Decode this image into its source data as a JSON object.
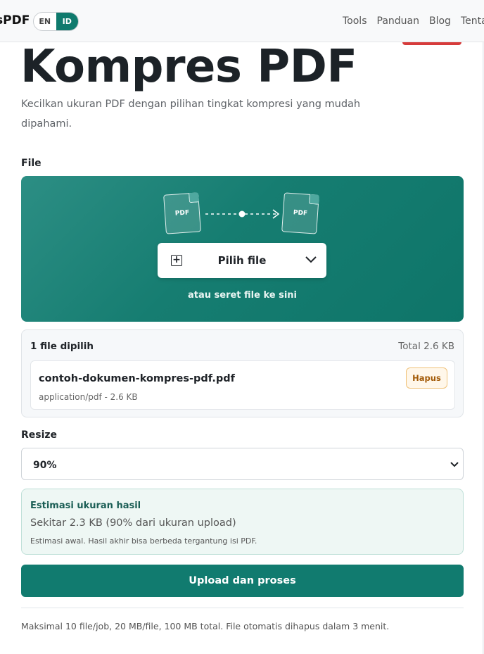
{
  "header": {
    "brand": "sPDF",
    "lang": {
      "en": "EN",
      "id": "ID",
      "active": "ID"
    },
    "nav": [
      "Tools",
      "Panduan",
      "Blog",
      "Tentang"
    ]
  },
  "page": {
    "title": "Kompres PDF",
    "subtitle": "Kecilkan ukuran PDF dengan pilihan tingkat kompresi yang mudah dipahami."
  },
  "file_section": {
    "label": "File",
    "doc_label_left": "PDF",
    "doc_label_right": "PDF",
    "pick_button": "Pilih file",
    "drop_hint": "atau seret file ke sini"
  },
  "selected": {
    "count": "1 file dipilih",
    "total": "Total 2.6 KB",
    "files": [
      {
        "name": "contoh-dokumen-kompres-pdf.pdf",
        "meta": "application/pdf - 2.6 KB",
        "remove": "Hapus"
      }
    ]
  },
  "resize": {
    "label": "Resize",
    "value": "90%"
  },
  "estimate": {
    "title": "Estimasi ukuran hasil",
    "body": "Sekitar 2.3 KB (90% dari ukuran upload)",
    "note": "Estimasi awal. Hasil akhir bisa berbeda tergantung isi PDF."
  },
  "upload_button": "Upload dan proses",
  "footnote": "Maksimal 10 file/job, 20 MB/file, 100 MB total. File otomatis dihapus dalam 3 menit.",
  "colors": {
    "accent": "#117b6f",
    "danger": "#d63b3b"
  }
}
